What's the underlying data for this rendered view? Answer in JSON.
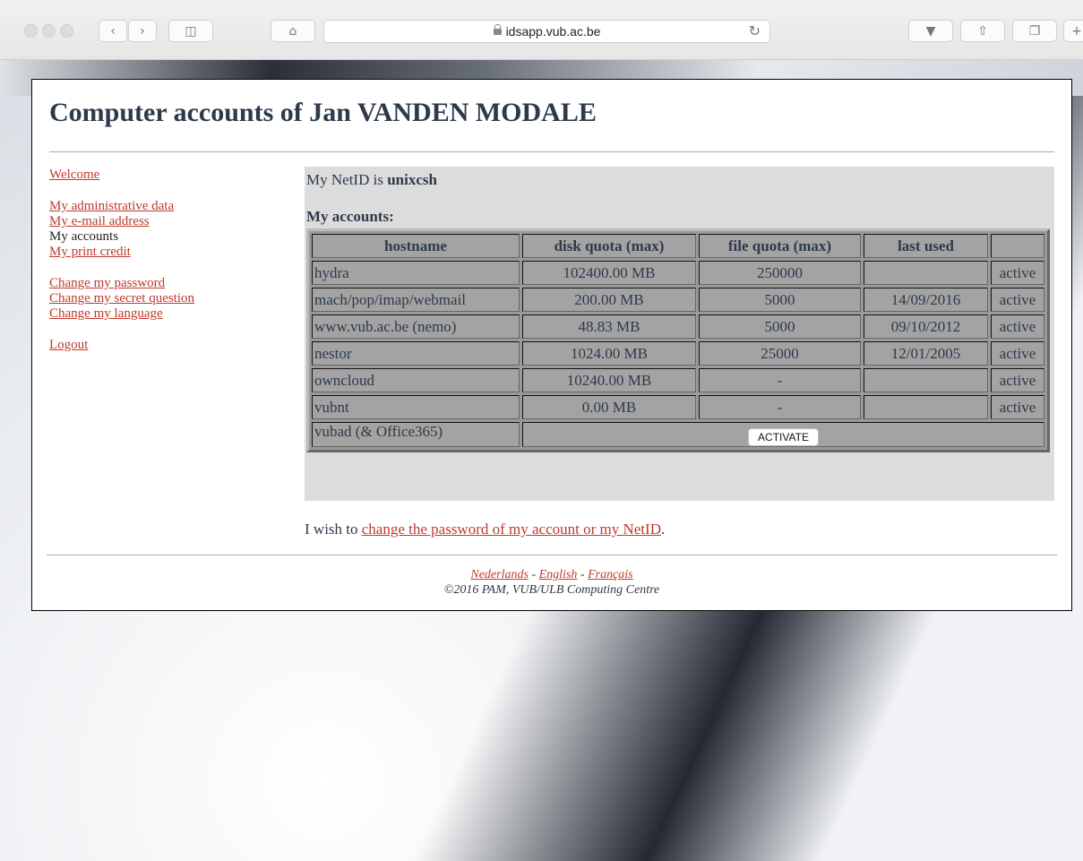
{
  "browser": {
    "url": "idsapp.vub.ac.be"
  },
  "page": {
    "title": "Computer accounts of Jan VANDEN MODALE"
  },
  "nav": {
    "welcome": "Welcome",
    "admin_data": "My administrative data",
    "email": "My e-mail address",
    "accounts": "My accounts",
    "print_credit": "My print credit",
    "change_password": "Change my password",
    "change_secret": "Change my secret question",
    "change_language": "Change my language",
    "logout": "Logout"
  },
  "content": {
    "netid_prefix": "My NetID is ",
    "netid": "unixcsh",
    "accounts_heading": "My accounts:",
    "columns": [
      "hostname",
      "disk quota (max)",
      "file quota (max)",
      "last used",
      ""
    ],
    "rows": [
      {
        "host": "hydra",
        "disk": "102400.00 MB",
        "file": "250000",
        "last": "",
        "status": "active"
      },
      {
        "host": "mach/pop/imap/webmail",
        "disk": "200.00 MB",
        "file": "5000",
        "last": "14/09/2016",
        "status": "active"
      },
      {
        "host": "www.vub.ac.be (nemo)",
        "disk": "48.83 MB",
        "file": "5000",
        "last": "09/10/2012",
        "status": "active"
      },
      {
        "host": "nestor",
        "disk": "1024.00 MB",
        "file": "25000",
        "last": "12/01/2005",
        "status": "active"
      },
      {
        "host": "owncloud",
        "disk": "10240.00 MB",
        "file": "-",
        "last": "",
        "status": "active"
      },
      {
        "host": "vubnt",
        "disk": "0.00 MB",
        "file": "-",
        "last": "",
        "status": "active"
      }
    ],
    "vubad_host": "vubad (& Office365)",
    "activate_label": "ACTIVATE",
    "wish_prefix": "I wish to ",
    "wish_link": "change the password of my account or my NetID",
    "wish_suffix": "."
  },
  "footer": {
    "lang_nl": "Nederlands",
    "sep1": " - ",
    "lang_en": "English",
    "sep2": " - ",
    "lang_fr": "Français",
    "copyright": "©2016 PAM, VUB/ULB Computing Centre"
  }
}
